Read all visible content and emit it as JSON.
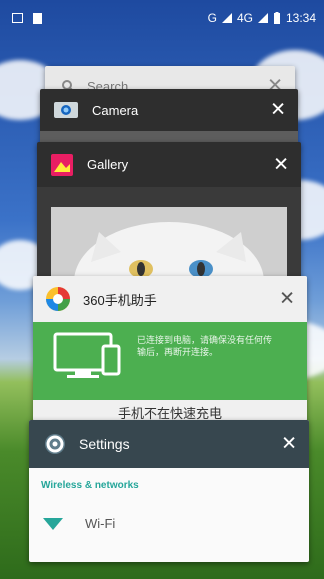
{
  "status": {
    "signal1": "G",
    "signal2": "4G",
    "time": "13:34"
  },
  "cards": {
    "search": {
      "title": "Search"
    },
    "camera": {
      "title": "Camera"
    },
    "gallery": {
      "title": "Gallery"
    },
    "app360": {
      "title": "360手机助手",
      "line1": "已连接到电脑，请确保没有任何传",
      "line2": "输后，再断开连接。",
      "bottom": "手机不在快速充电"
    },
    "settings": {
      "title": "Settings",
      "section": "Wireless & networks",
      "item1": "Wi-Fi"
    }
  },
  "colors": {
    "accent": "#26a69a",
    "green": "#4caf50"
  }
}
